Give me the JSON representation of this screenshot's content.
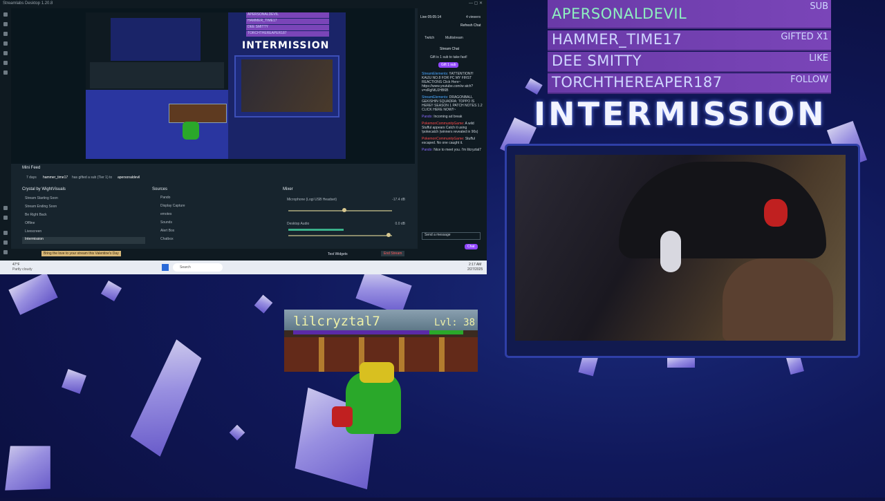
{
  "app": {
    "title": "Streamlabs Desktop 1.20.8"
  },
  "preview": {
    "alerts": [
      "APERSONALDEVIL",
      "HAMMER_TIME17",
      "DEE SMITTY",
      "TORCHTHEREAPER187"
    ],
    "alert_types": [
      "SUB",
      "GIFTED X1",
      "LIKE",
      "FOLLOW"
    ],
    "title": "INTERMISSION"
  },
  "mini_feed": {
    "title": "Mini Feed",
    "age": "7 days",
    "event_user": "hammer_time17",
    "event_text": "has gifted a sub (Tier 1) to",
    "event_target": "apersonaldevil"
  },
  "scenes": {
    "title": "Crystal by WightVisuals",
    "items": [
      "Stream Starting Soon",
      "Stream Ending Soon",
      "Be Right Back",
      "Offline",
      "Livescreen",
      "Intermission"
    ],
    "selected_index": 5
  },
  "sources": {
    "title": "Sources",
    "items": [
      "Pando",
      "Display Capture",
      "emotes",
      "Sounds",
      "Alert Box",
      "Chatbox"
    ]
  },
  "mixer": {
    "title": "Mixer",
    "channels": [
      {
        "name": "Microphone (Logi USB Headset)",
        "db": "-17.4 dB"
      },
      {
        "name": "Desktop Audio",
        "db": "0.0 dB"
      }
    ]
  },
  "footer": {
    "banner": "Bring the love to your stream this Valentine's Day",
    "test_widgets": "Test Widgets",
    "end_stream": "End Stream"
  },
  "chat": {
    "live": "Live 05:05:14",
    "viewers": "4 viewers",
    "refresh": "Refresh Chat",
    "tabs": [
      "Twitch",
      "Multistream"
    ],
    "stream_chat": "Stream Chat",
    "gift_prompt": "Gift is 1 sub to take fast!",
    "gift_btn": "Gift 1 sub",
    "messages": [
      {
        "user": "StreamElements:",
        "text": "!!ATTENTION!!! KAIJU NO.8 FOR PC MY FIRST REACTIONS Click Here~ https://www.youtube.com/w atch?v=xRgNtUJHB6B"
      },
      {
        "user": "StreamElements:",
        "text": "DRAGONBALL GEKISHIN SQUADRA: TOPPO IS HERE!! SEASON 1 PATCH NOTES 1.2 CLICK HERE NOW!!~"
      },
      {
        "user": "Pando:",
        "text": "Incoming ad break"
      },
      {
        "user": "PokemonCommunityGame:",
        "text": "A wild Stufful appears Catch it using !pokecatch (winners revealed in 90s)"
      },
      {
        "user": "PokemonCommunityGame:",
        "text": "Stufful escaped. No one caught it."
      },
      {
        "user": "Pando:",
        "text": "Nice to meet you. I'm lilcryztal7"
      }
    ],
    "input_placeholder": "Send a message",
    "send": "Chat"
  },
  "taskbar": {
    "weather": "47°F",
    "weather_sub": "Partly cloudy",
    "search": "Search",
    "time": "2:17 AM",
    "date": "2/27/2025"
  },
  "overlay": {
    "alerts": [
      {
        "name": "APERSONALDEVIL",
        "type": "SUB"
      },
      {
        "name": "HAMMER_TIME17",
        "type": "GIFTED X1"
      },
      {
        "name": "DEE SMITTY",
        "type": "LIKE"
      },
      {
        "name": "TORCHTHEREAPER187",
        "type": "FOLLOW"
      }
    ],
    "title": "INTERMISSION"
  },
  "game": {
    "name": "lilcryztal7",
    "level": "Lvl: 38",
    "xp_fraction": 0.2
  },
  "colors": {
    "alert_bg": "#7a45b8",
    "accent_purple": "#9147ff",
    "end_stream": "#d63b3b"
  }
}
